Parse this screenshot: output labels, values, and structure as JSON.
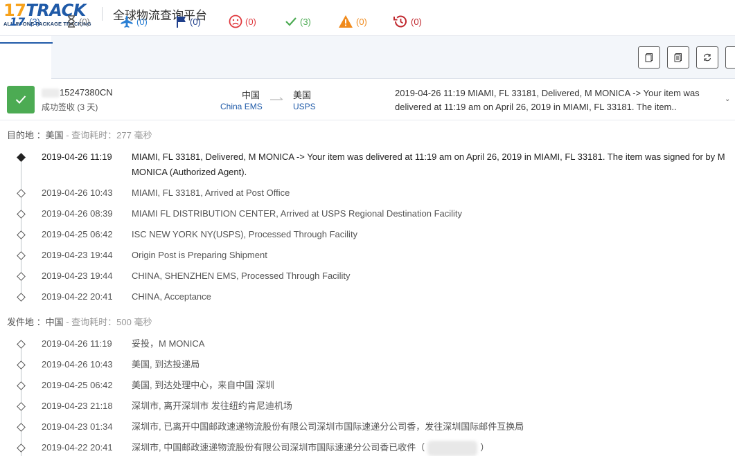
{
  "header": {
    "logo_main": "17TRACK",
    "logo_sub": "ALL-IN-ONE PACKAGE TRACKING",
    "title": "全球物流查询平台"
  },
  "tabs": [
    {
      "name": "all",
      "count": "(3)",
      "color": "#1f5aa8"
    },
    {
      "name": "hourglass",
      "count": "(0)",
      "color": "#777777"
    },
    {
      "name": "transit",
      "count": "(0)",
      "color": "#2a7fd4"
    },
    {
      "name": "pickup",
      "count": "(0)",
      "color": "#1f3f8b"
    },
    {
      "name": "undelivered",
      "count": "(0)",
      "color": "#e0393e"
    },
    {
      "name": "delivered",
      "count": "(3)",
      "color": "#4cab53"
    },
    {
      "name": "alert",
      "count": "(0)",
      "color": "#f08a1c"
    },
    {
      "name": "expired",
      "count": "(0)",
      "color": "#c0272d"
    }
  ],
  "summary": {
    "tracking_number_suffix": "15247380CN",
    "status": "成功签收 (3 天)",
    "origin_country": "中国",
    "origin_carrier": "China EMS",
    "dest_country": "美国",
    "dest_carrier": "USPS",
    "latest_event": "2019-04-26 11:19   MIAMI, FL 33181, Delivered, M MONICA -> Your item was delivered at 11:19 am on April 26, 2019 in MIAMI, FL 33181. The item..",
    "expand_glyph": "⌄"
  },
  "destination": {
    "label": "目的地 ：美国",
    "timing": " - 查询耗时：277 毫秒",
    "events": [
      {
        "time": "2019-04-26 11:19",
        "desc": "MIAMI, FL 33181, Delivered, M MONICA -> Your item was delivered at 11:19 am on April 26, 2019 in MIAMI, FL 33181. The item was signed for by M MONICA (Authorized Agent)."
      },
      {
        "time": "2019-04-26 10:43",
        "desc": "MIAMI, FL 33181, Arrived at Post Office"
      },
      {
        "time": "2019-04-26 08:39",
        "desc": "MIAMI FL DISTRIBUTION CENTER, Arrived at USPS Regional Destination Facility"
      },
      {
        "time": "2019-04-25 06:42",
        "desc": "ISC NEW YORK NY(USPS), Processed Through Facility"
      },
      {
        "time": "2019-04-23 19:44",
        "desc": "Origin Post is Preparing Shipment"
      },
      {
        "time": "2019-04-23 19:44",
        "desc": "CHINA, SHENZHEN EMS, Processed Through Facility"
      },
      {
        "time": "2019-04-22 20:41",
        "desc": "CHINA, Acceptance"
      }
    ]
  },
  "origin": {
    "label": "发件地 ：中国",
    "timing": " - 查询耗时：500 毫秒",
    "events": [
      {
        "time": "2019-04-26 11:19",
        "desc": "妥投，M MONICA"
      },
      {
        "time": "2019-04-26 10:43",
        "desc": "美国, 到达投递局"
      },
      {
        "time": "2019-04-25 06:42",
        "desc": "美国, 到达处理中心，来自中国 深圳"
      },
      {
        "time": "2019-04-23 21:18",
        "desc": "深圳市, 离开深圳市 发往纽约肯尼迪机场"
      },
      {
        "time": "2019-04-23 01:34",
        "desc": "深圳市, 已离开中国邮政速递物流股份有限公司深圳市国际速递分公司香，发往深圳国际邮件互换局"
      },
      {
        "time": "2019-04-22 20:41",
        "desc_prefix": "深圳市, 中国邮政速递物流股份有限公司深圳市国际速递分公司香已收件（",
        "desc_suffix": "）"
      }
    ]
  }
}
